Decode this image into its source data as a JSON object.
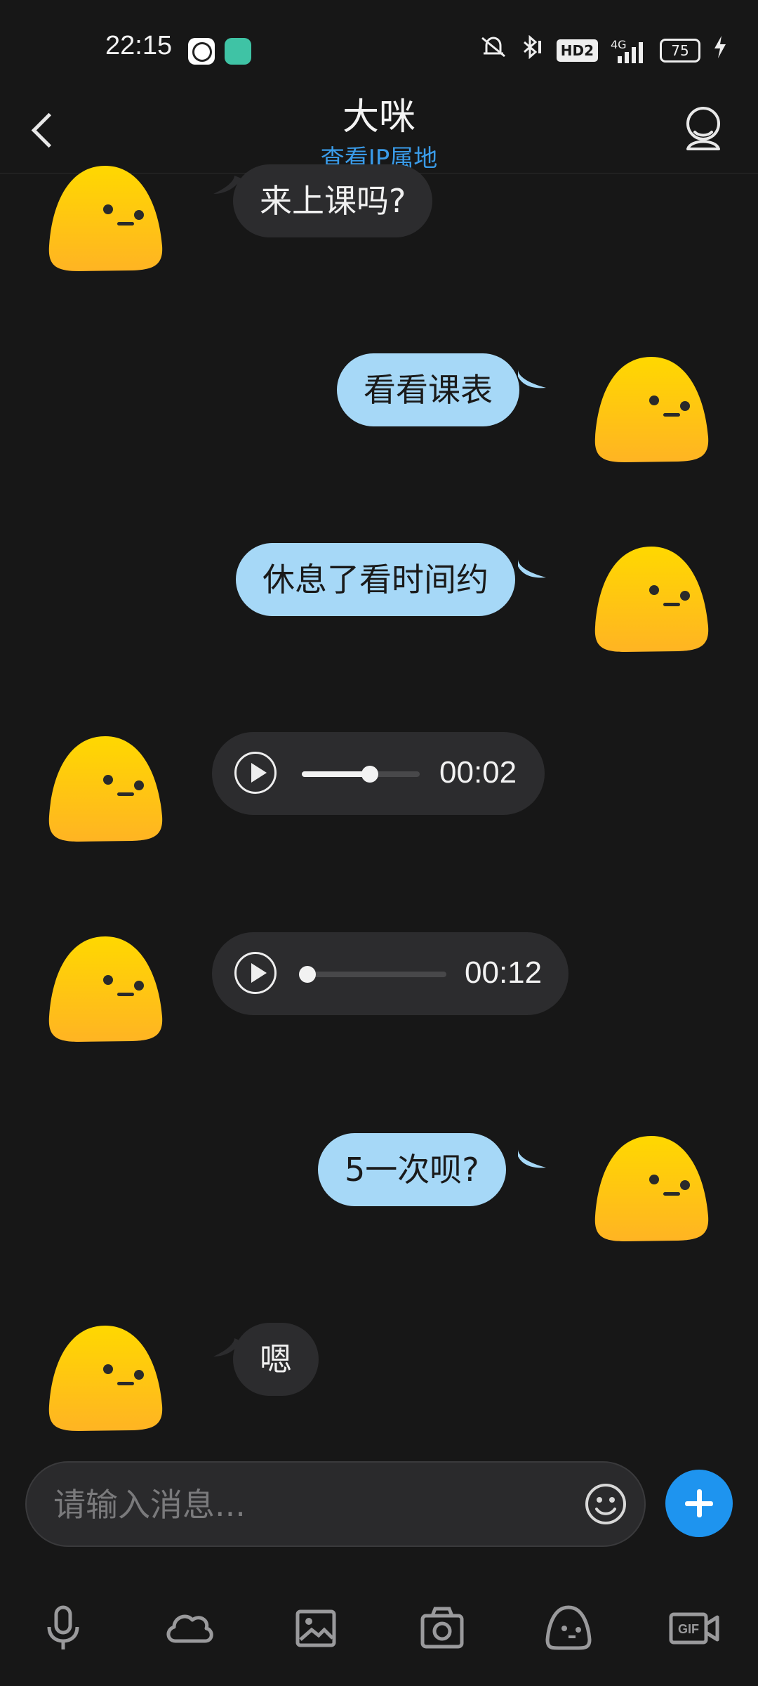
{
  "status_bar": {
    "time": "22:15",
    "network": "4G",
    "hd_badge": "HD2",
    "battery": "75",
    "icons": [
      "mute-icon",
      "bluetooth-icon",
      "hd-icon",
      "signal-icon",
      "battery-icon",
      "charging-icon"
    ]
  },
  "header": {
    "title": "大咪",
    "subtitle": "查看IP属地"
  },
  "messages": [
    {
      "side": "in",
      "type": "text",
      "text": "来上课吗?"
    },
    {
      "side": "out",
      "type": "text",
      "text": "看看课表"
    },
    {
      "side": "out",
      "type": "text",
      "text": "休息了看时间约"
    },
    {
      "side": "in",
      "type": "voice",
      "duration": "00:02",
      "progress": 0.58
    },
    {
      "side": "in",
      "type": "voice",
      "duration": "00:12",
      "progress": 0.0
    },
    {
      "side": "out",
      "type": "text",
      "text": "5一次呗?"
    },
    {
      "side": "in",
      "type": "text",
      "text": "嗯"
    }
  ],
  "input": {
    "placeholder": "请输入消息..."
  },
  "toolbar": [
    "microphone-icon",
    "cloud-icon",
    "image-icon",
    "camera-icon",
    "sticker-face-icon",
    "gif-video-icon"
  ],
  "colors": {
    "background": "#171717",
    "incoming_bubble": "#2c2c2e",
    "outgoing_bubble": "#a6d8f7",
    "accent": "#1e94ef",
    "avatar_top": "#ffd400",
    "avatar_bottom": "#ffb21f"
  }
}
